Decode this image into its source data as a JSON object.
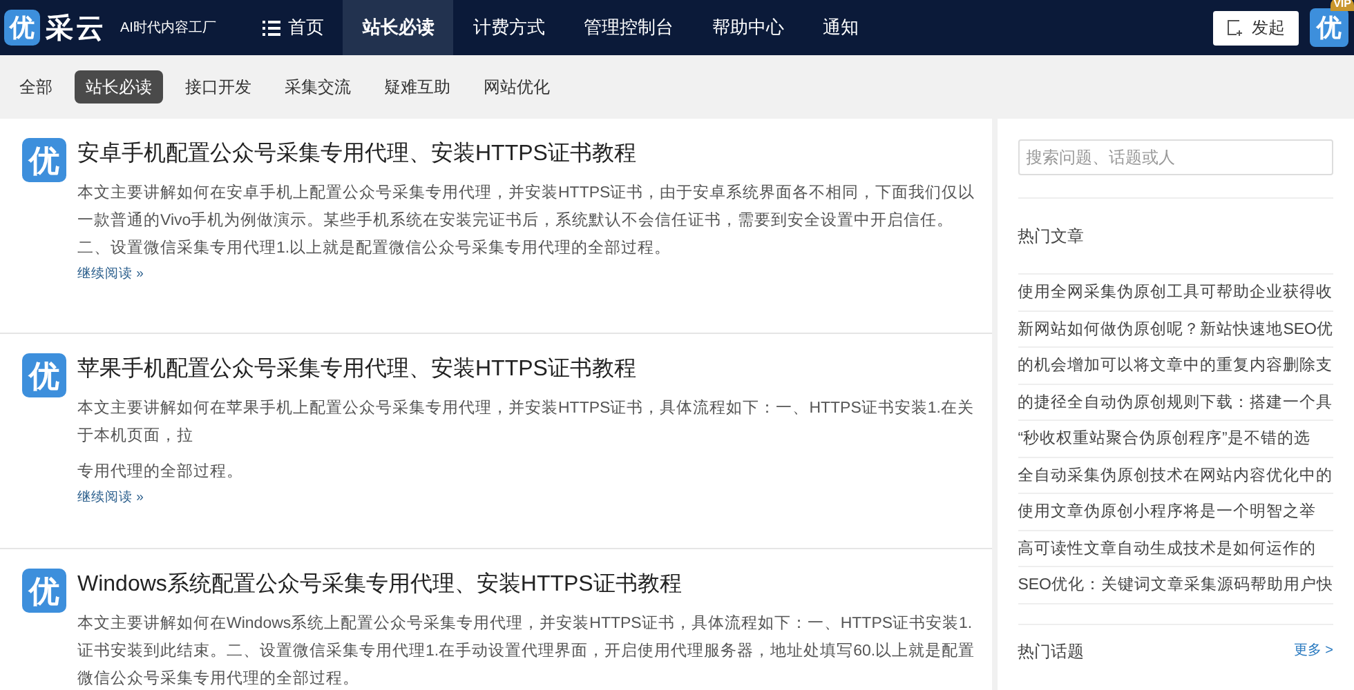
{
  "header": {
    "logo_char": "优",
    "brand": "采云",
    "slogan": "AI时代内容工厂",
    "nav": [
      {
        "label": "首页",
        "selected": false,
        "kind": "menu"
      },
      {
        "label": "站长必读",
        "selected": true,
        "kind": "plain"
      },
      {
        "label": "计费方式",
        "selected": false,
        "kind": "plain"
      },
      {
        "label": "管理控制台",
        "selected": false,
        "kind": "plain"
      },
      {
        "label": "帮助中心",
        "selected": false,
        "kind": "plain"
      },
      {
        "label": "通知",
        "selected": false,
        "kind": "plain"
      }
    ],
    "post_button": "发起",
    "avatar_char": "优",
    "vip_badge": "VIP"
  },
  "categories": [
    {
      "label": "全部",
      "selected": false
    },
    {
      "label": "站长必读",
      "selected": true
    },
    {
      "label": "接口开发",
      "selected": false
    },
    {
      "label": "采集交流",
      "selected": false
    },
    {
      "label": "疑难互助",
      "selected": false
    },
    {
      "label": "网站优化",
      "selected": false
    }
  ],
  "articles": [
    {
      "icon_char": "优",
      "title": "安卓手机配置公众号采集专用代理、安装HTTPS证书教程",
      "body": [
        "本文主要讲解如何在安卓手机上配置公众号采集专用代理，并安装HTTPS证书，由于安卓系统界面各不相同，下面我们仅以一款普通的Vivo手机为例做演示。某些手机系统在安装完证书后，系统默认不会信任证书，需要到安全设置中开启信任。二、设置微信采集专用代理1.以上就是配置微信公众号采集专用代理的全部过程。"
      ],
      "more": "继续阅读 »"
    },
    {
      "icon_char": "优",
      "title": "苹果手机配置公众号采集专用代理、安装HTTPS证书教程",
      "body": [
        "本文主要讲解如何在苹果手机上配置公众号采集专用代理，并安装HTTPS证书，具体流程如下：一、HTTPS证书安装1.在关于本机页面，拉",
        "专用代理的全部过程。"
      ],
      "more": "继续阅读 »"
    },
    {
      "icon_char": "优",
      "title": "Windows系统配置公众号采集专用代理、安装HTTPS证书教程",
      "body": [
        "本文主要讲解如何在Windows系统上配置公众号采集专用代理，并安装HTTPS证书，具体流程如下：一、HTTPS证书安装1.证书安装到此结束。二、设置微信采集专用代理1.在手动设置代理界面，开启使用代理服务器，地址处填写60.以上就是配置微信公众号采集专用代理的全部过程。"
      ]
    }
  ],
  "sidebar": {
    "search": {
      "placeholder": "搜索问题、话题或人"
    },
    "hot_articles": {
      "title": "热门文章",
      "items": [
        "使用全网采集伪原创工具可帮助企业获得收",
        "新网站如何做伪原创呢？新站快速地SEO优",
        "的机会增加可以将文章中的重复内容删除支",
        "的捷径全自动伪原创规则下载：搭建一个具",
        "“秒收权重站聚合伪原创程序”是不错的选",
        "全自动采集伪原创技术在网站内容优化中的",
        "使用文章伪原创小程序将是一个明智之举",
        "高可读性文章自动生成技术是如何运作的",
        "SEO优化：关键词文章采集源码帮助用户快"
      ]
    },
    "hot_topics": {
      "title": "热门话题",
      "more": "更多 >"
    }
  }
}
